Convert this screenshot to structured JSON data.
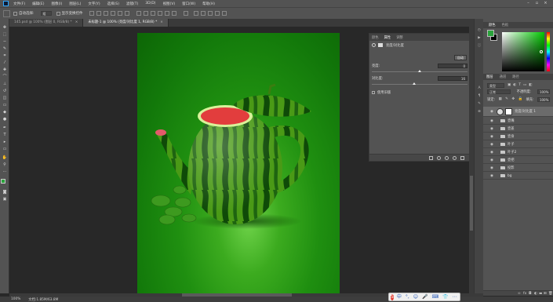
{
  "menu": {
    "items": [
      "文件(F)",
      "编辑(E)",
      "图像(I)",
      "图层(L)",
      "文字(Y)",
      "选择(S)",
      "滤镜(T)",
      "3D(D)",
      "视图(V)",
      "窗口(W)",
      "帮助(H)"
    ],
    "window_controls": [
      "minimize-icon",
      "restore-icon",
      "close-icon"
    ]
  },
  "options": {
    "auto_select_label": "自动选择:",
    "group_value": "组",
    "show_transform_label": "显示变换控件"
  },
  "tabs": [
    {
      "label": "145.psd @ 100% (图层 0, RGB/8) *",
      "close": "×"
    },
    {
      "label": "未标题-1 @ 100% (亮度/对比度 1, RGB/8) *",
      "close": "×"
    }
  ],
  "properties": {
    "tabs": [
      "颜色",
      "属性",
      "调整"
    ],
    "title": "亮度/对比度",
    "auto_label": "自动",
    "brightness_label": "亮度:",
    "brightness_value": "0",
    "contrast_label": "对比度:",
    "contrast_value": "16",
    "legacy_label": "使用旧版"
  },
  "color": {
    "tabs": [
      "颜色",
      "色板"
    ],
    "foreground": "#2aa33b",
    "background": "#000000"
  },
  "layers": {
    "tabs": [
      "图层",
      "通道",
      "路径"
    ],
    "filter_kind": "类型",
    "blend_mode": "正常",
    "opacity_label": "不透明度:",
    "opacity_value": "100%",
    "lock_label": "锁定:",
    "fill_label": "填充:",
    "fill_value": "100%",
    "selected_layer": "亮度/对比度 1",
    "items": [
      "壶嘴",
      "壶盖",
      "壶身",
      "叶子",
      "叶子2",
      "壶把",
      "投影",
      "bg"
    ]
  },
  "status": {
    "zoom": "100%",
    "doc_info": "文档:1.85M/63.8M"
  },
  "ime": {
    "logo": "S",
    "items": [
      "中",
      "°,",
      "☺",
      "🎤",
      "⌨",
      "👕",
      "⋯"
    ]
  }
}
